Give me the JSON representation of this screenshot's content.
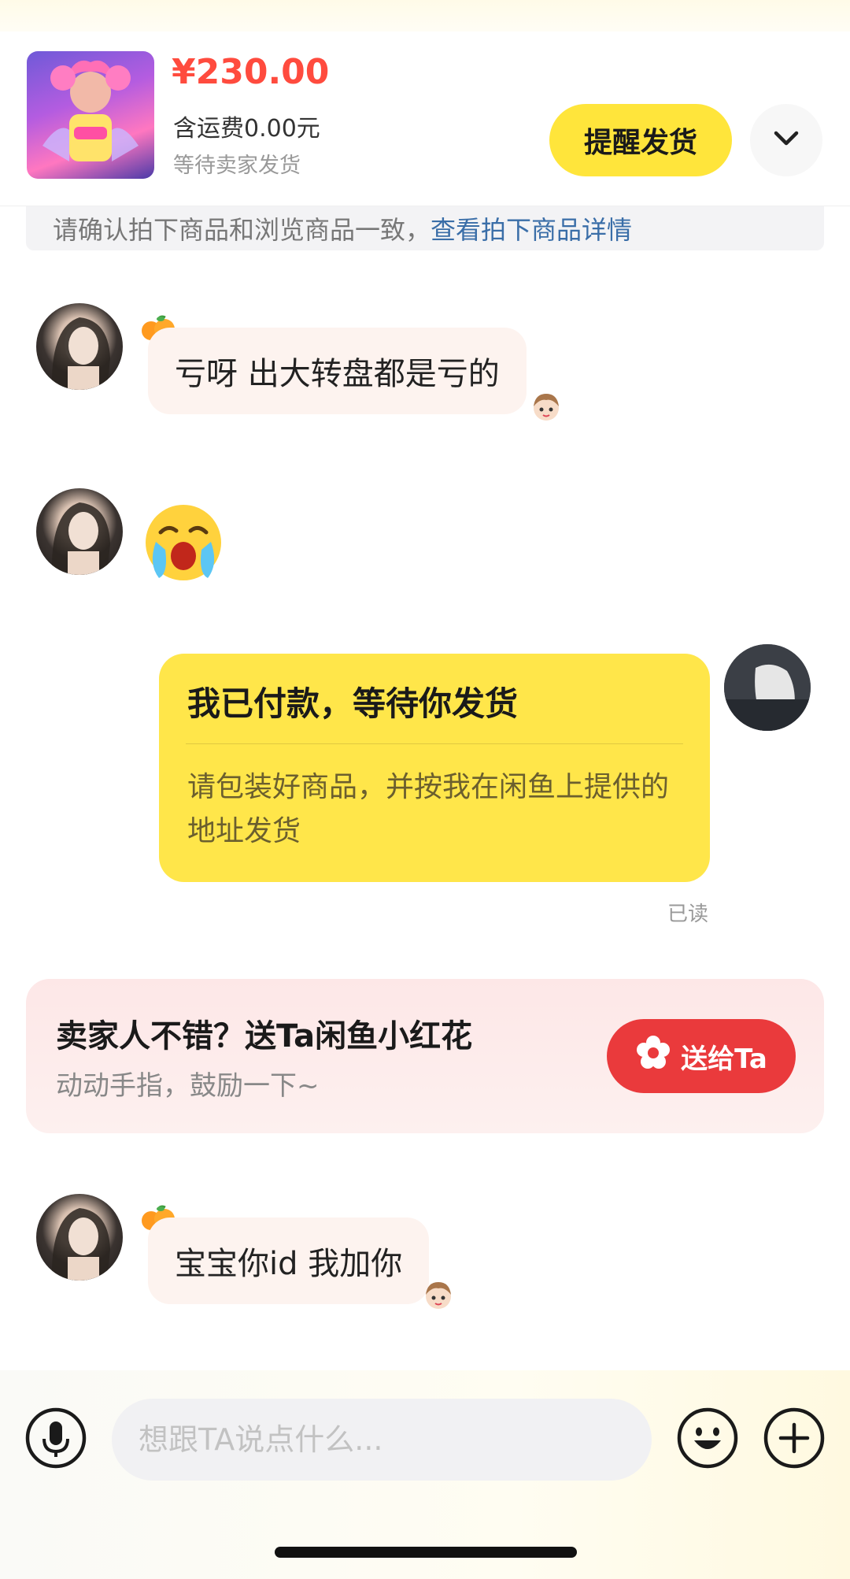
{
  "order": {
    "price": "¥230.00",
    "shipping": "含运费0.00元",
    "status": "等待卖家发货",
    "remind_label": "提醒发货",
    "confirm_text": "请确认拍下商品和浏览商品一致，",
    "confirm_link": "查看拍下商品详情"
  },
  "messages": {
    "m1": "亏呀 出大转盘都是亏的",
    "m4": "宝宝你id 我加你"
  },
  "payment_card": {
    "title": "我已付款，等待你发货",
    "body": "请包装好商品，并按我在闲鱼上提供的地址发货",
    "read": "已读"
  },
  "flower": {
    "title": "卖家人不错？送Ta闲鱼小红花",
    "subtitle": "动动手指，鼓励一下~",
    "button": "送给Ta"
  },
  "input": {
    "placeholder": "想跟TA说点什么..."
  },
  "colors": {
    "accent_yellow": "#ffe53b",
    "price_red": "#ff4b3e",
    "flower_red": "#ea3a3c",
    "link_blue": "#3a6ea8"
  },
  "icons": [
    "chevron-down-icon",
    "microphone-icon",
    "emoji-icon",
    "plus-icon",
    "flower-icon",
    "crying-emoji",
    "orange-badge-icon",
    "sticker-face-icon"
  ]
}
